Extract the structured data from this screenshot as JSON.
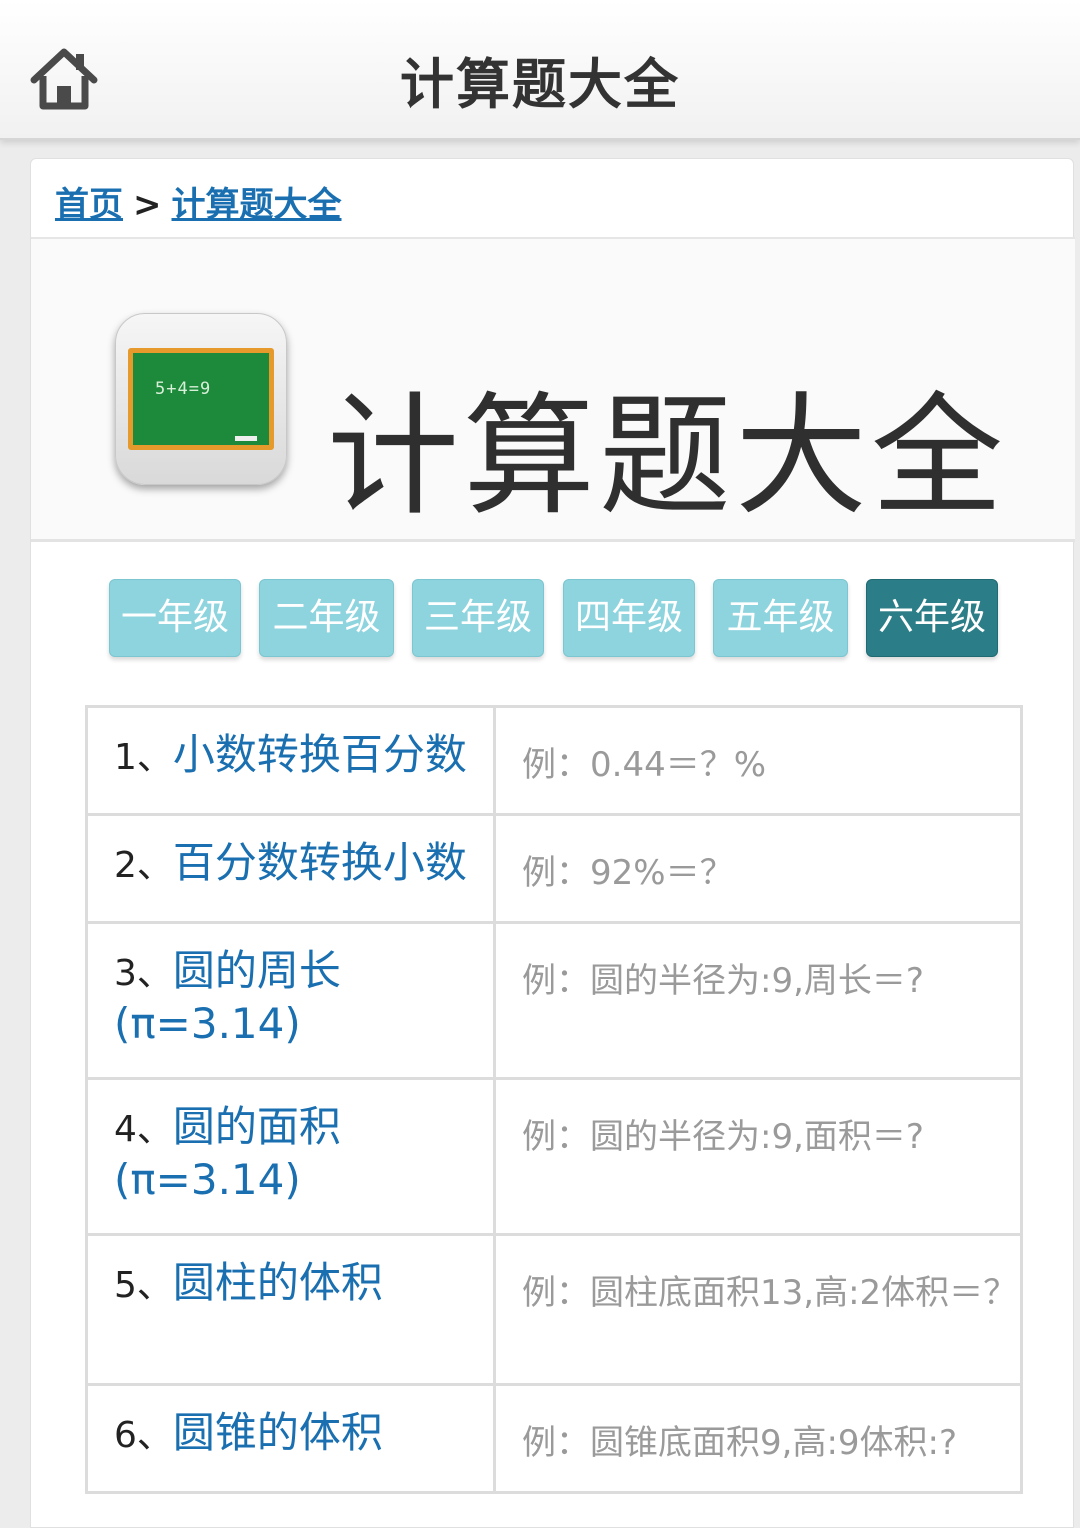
{
  "header": {
    "title": "计算题大全",
    "home_icon": "home-icon"
  },
  "breadcrumb": {
    "home": "首页",
    "separator": ">",
    "current": "计算题大全"
  },
  "hero": {
    "title": "计算题大全",
    "icon_text": "5+4=9"
  },
  "grades": [
    {
      "label": "一年级",
      "active": false
    },
    {
      "label": "二年级",
      "active": false
    },
    {
      "label": "三年级",
      "active": false
    },
    {
      "label": "四年级",
      "active": false
    },
    {
      "label": "五年级",
      "active": false
    },
    {
      "label": "六年级",
      "active": true
    }
  ],
  "topics": [
    {
      "num": "1、",
      "title": "小数转换百分数",
      "example": "例：0.44＝？%"
    },
    {
      "num": "2、",
      "title": "百分数转换小数",
      "example": "例：92%＝？"
    },
    {
      "num": "3、",
      "title": "圆的周长(π=3.14)",
      "example": "例：圆的半径为:9,周长＝?"
    },
    {
      "num": "4、",
      "title": "圆的面积(π=3.14)",
      "example": "例：圆的半径为:9,面积＝?"
    },
    {
      "num": "5、",
      "title": "圆柱的体积",
      "example": "例：圆柱底面积13,高:2体积＝？"
    },
    {
      "num": "6、",
      "title": "圆锥的体积",
      "example": "例：圆锥底面积9,高:9体积:?"
    }
  ],
  "colors": {
    "link": "#1a6fb0",
    "tab": "#8dd4de",
    "tab_active": "#2b7e87"
  }
}
